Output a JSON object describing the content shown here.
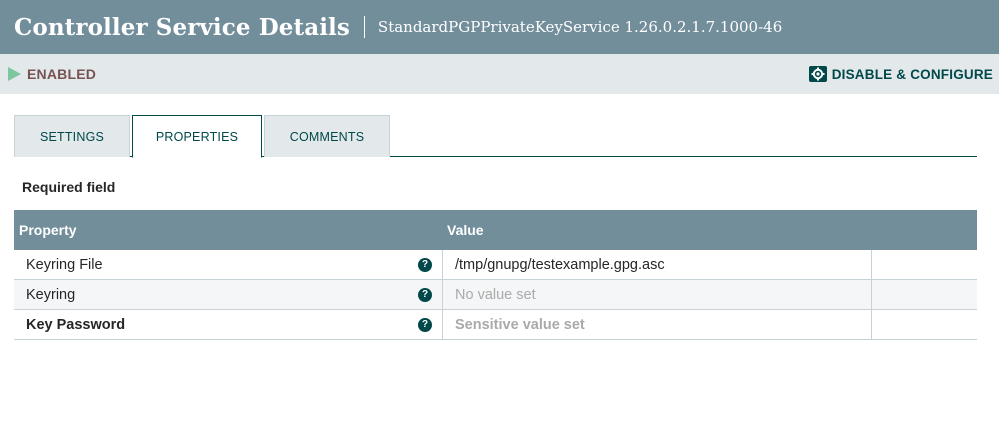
{
  "header": {
    "title": "Controller Service Details",
    "subtitle": "StandardPGPPrivateKeyService 1.26.0.2.1.7.1000-46"
  },
  "status": {
    "label": "ENABLED",
    "icon": "play-icon",
    "color": "#7dc7a0"
  },
  "actions": {
    "disable_configure_label": "DISABLE & CONFIGURE",
    "icon": "gear-icon"
  },
  "tabs": [
    {
      "label": "SETTINGS",
      "active": false
    },
    {
      "label": "PROPERTIES",
      "active": true
    },
    {
      "label": "COMMENTS",
      "active": false
    }
  ],
  "required_label": "Required field",
  "table": {
    "columns": [
      "Property",
      "Value"
    ],
    "rows": [
      {
        "property": "Keyring File",
        "value": "/tmp/gnupg/testexample.gpg.asc",
        "required": false,
        "value_state": "set"
      },
      {
        "property": "Keyring",
        "value": "No value set",
        "required": false,
        "value_state": "unset"
      },
      {
        "property": "Key Password",
        "value": "Sensitive value set",
        "required": true,
        "value_state": "sensitive"
      }
    ],
    "help_icon_glyph": "?"
  },
  "colors": {
    "header_bg": "#728e9b",
    "accent": "#004849",
    "status_text": "#775351"
  }
}
